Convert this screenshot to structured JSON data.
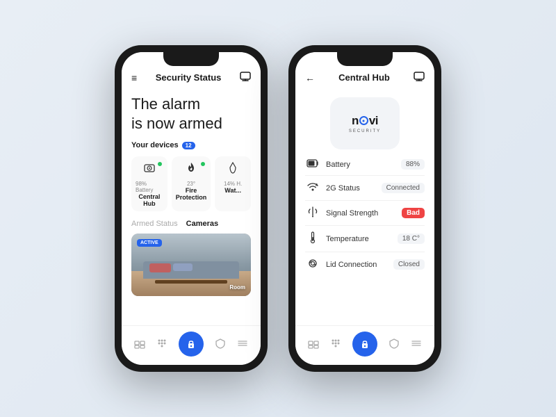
{
  "phone1": {
    "header": {
      "title": "Security Status",
      "menu_icon": "≡",
      "notification_icon": "🗨"
    },
    "alarm_text_line1": "The alarm",
    "alarm_text_line2": "is now armed",
    "devices_section": {
      "label": "Your devices",
      "count": "12",
      "devices": [
        {
          "icon": "📷",
          "stat": "98% Battery",
          "name": "Central Hub",
          "dot": true
        },
        {
          "icon": "🔥",
          "stat": "23°",
          "name": "Fire Protection",
          "dot": true
        },
        {
          "icon": "💧",
          "stat": "14% H.",
          "name": "Wat...",
          "dot": false
        }
      ]
    },
    "status_tabs": [
      {
        "label": "Armed Status",
        "active": false
      },
      {
        "label": "Cameras",
        "active": true
      }
    ],
    "camera": {
      "active_label": "ACTIVE",
      "room_label": "Room"
    },
    "bottom_nav": [
      {
        "icon": "⊞",
        "name": "home"
      },
      {
        "icon": "⌨",
        "name": "keypad"
      },
      {
        "icon": "🔒",
        "name": "lock",
        "active": true
      },
      {
        "icon": "◈",
        "name": "shield"
      },
      {
        "icon": "⊕",
        "name": "more"
      }
    ]
  },
  "phone2": {
    "header": {
      "title": "Central Hub",
      "back_icon": "←",
      "notification_icon": "🗨"
    },
    "logo": {
      "text_before": "n",
      "text_after": "vi",
      "sub": "SECURITY"
    },
    "info_rows": [
      {
        "icon": "🔋",
        "label": "Battery",
        "value": "88%",
        "bad": false
      },
      {
        "icon": "📶",
        "label": "2G Status",
        "value": "Connected",
        "bad": false
      },
      {
        "icon": "📡",
        "label": "Signal Strength",
        "value": "Bad",
        "bad": true
      },
      {
        "icon": "🌡",
        "label": "Temperature",
        "value": "18 C°",
        "bad": false
      },
      {
        "icon": "⊙",
        "label": "Lid Connection",
        "value": "Closed",
        "bad": false
      }
    ],
    "bottom_nav": [
      {
        "icon": "⊞",
        "name": "home"
      },
      {
        "icon": "⌨",
        "name": "keypad"
      },
      {
        "icon": "🔒",
        "name": "lock",
        "active": true
      },
      {
        "icon": "◈",
        "name": "shield"
      },
      {
        "icon": "⊕",
        "name": "more"
      }
    ]
  }
}
